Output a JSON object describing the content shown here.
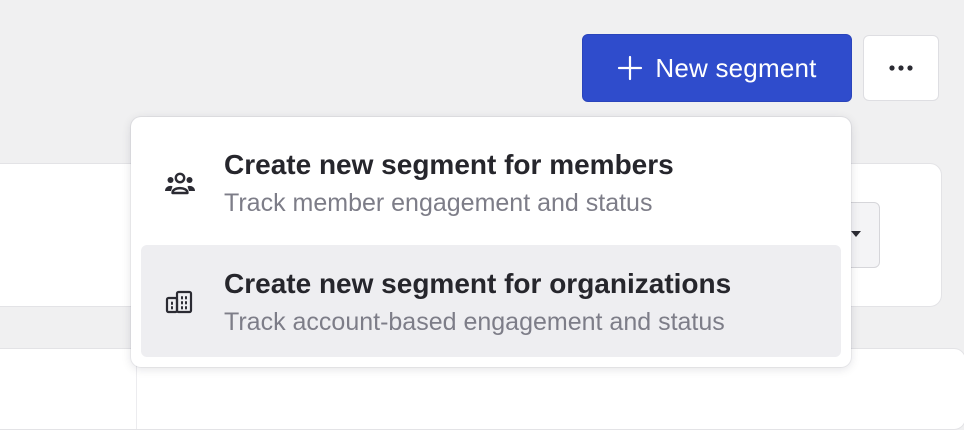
{
  "toolbar": {
    "new_segment_label": "New segment",
    "new_segment_icon": "plus-icon",
    "more_icon": "more-horizontal-icon",
    "primary_color": "#2f4ccc"
  },
  "dropdown": {
    "items": [
      {
        "title": "Create new segment for members",
        "subtitle": "Track member engagement and status",
        "icon": "members-icon"
      },
      {
        "title": "Create new segment for organizations",
        "subtitle": "Track account-based engagement and status",
        "icon": "organizations-icon",
        "highlighted": true
      }
    ]
  }
}
